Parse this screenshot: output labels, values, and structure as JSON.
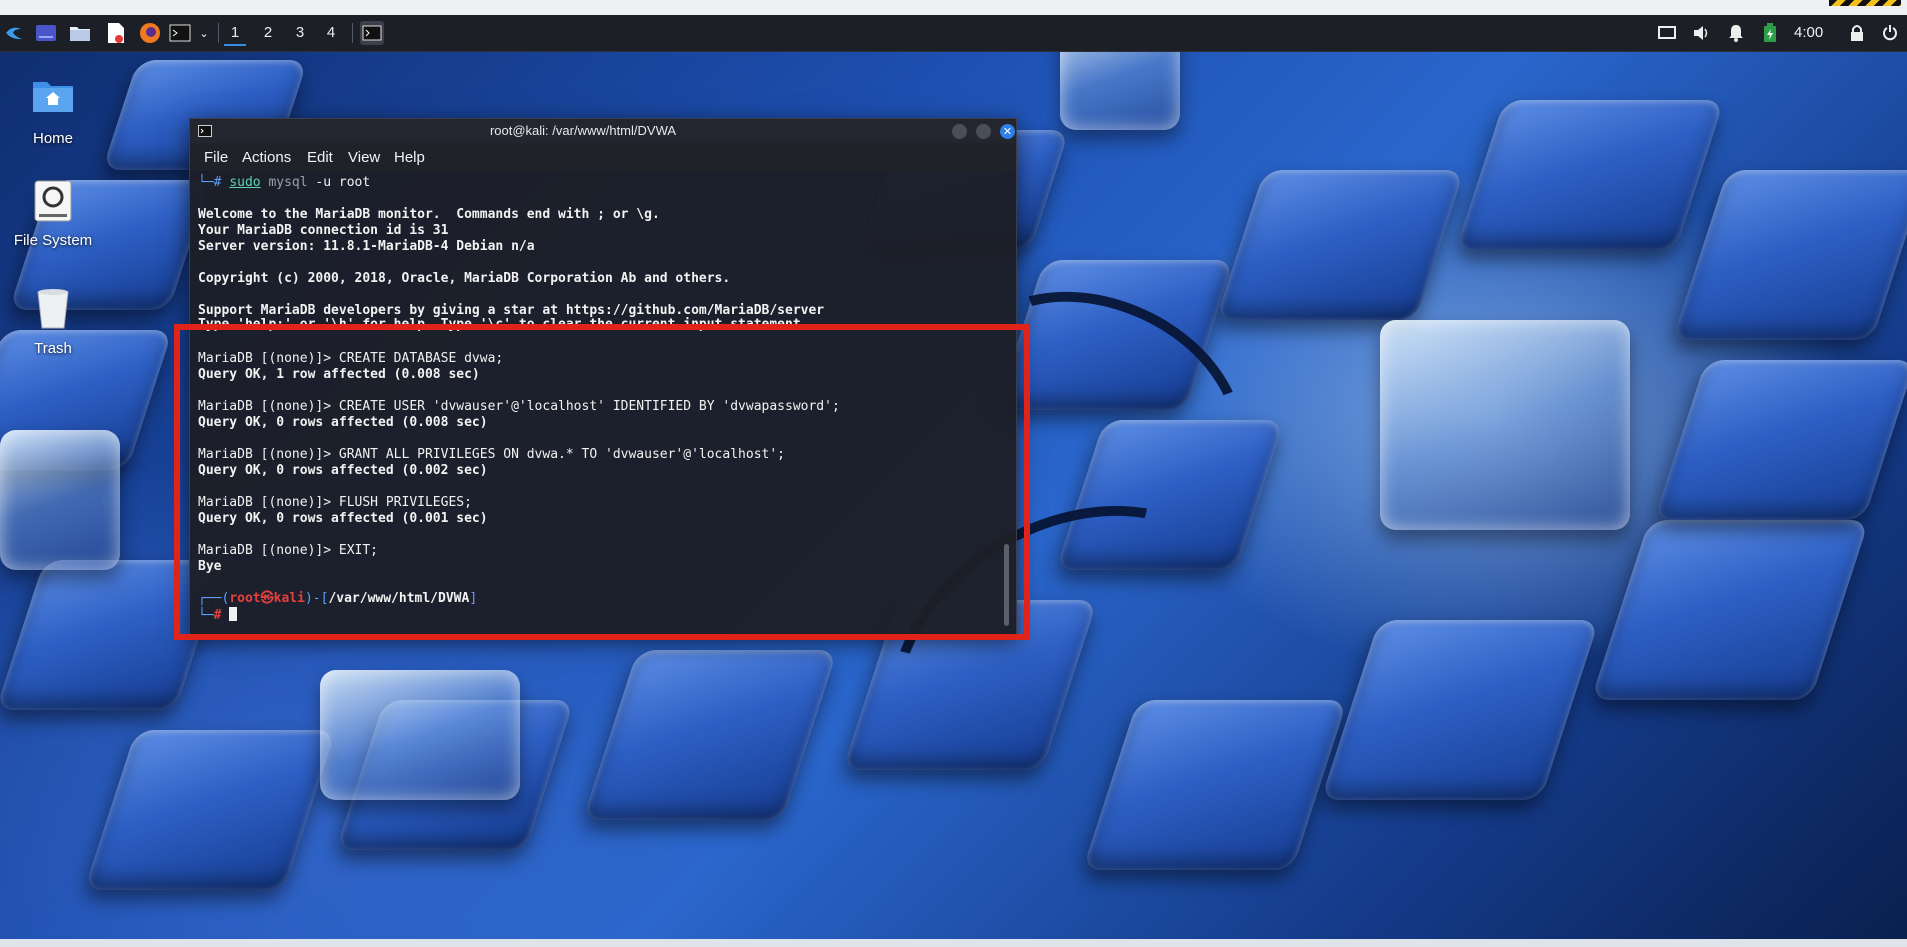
{
  "taskbar": {
    "workspaces": [
      "1",
      "2",
      "3",
      "4"
    ],
    "clock": "4:00",
    "icons": [
      "kali-menu-icon",
      "desktop-icon",
      "file-manager-icon",
      "text-editor-icon",
      "firefox-icon",
      "terminal-icon",
      "dropdown-icon",
      "terminal-task-icon",
      "display-icon",
      "volume-icon",
      "notification-icon",
      "battery-icon",
      "lock-icon",
      "power-icon"
    ]
  },
  "desktop": {
    "icons": [
      {
        "label": "Home",
        "icon": "home-folder-icon"
      },
      {
        "label": "File System",
        "icon": "drive-icon"
      },
      {
        "label": "Trash",
        "icon": "trash-icon"
      }
    ]
  },
  "terminal": {
    "title": "root@kali: /var/www/html/DVWA",
    "menu": [
      "File",
      "Actions",
      "Edit",
      "View",
      "Help"
    ],
    "prompt_cmd": {
      "prefix": "└─# ",
      "sudo": "sudo",
      "mysql": "mysql",
      "args": " -u root"
    },
    "lines": {
      "welcome": "Welcome to the MariaDB monitor.  Commands end with ; or \\g.",
      "connection": "Your MariaDB connection id is 31",
      "server": "Server version: 11.8.1-MariaDB-4 Debian n/a",
      "copyright": "Copyright (c) 2000, 2018, Oracle, MariaDB Corporation Ab and others.",
      "support": "Support MariaDB developers by giving a star at https://github.com/MariaDB/server",
      "help": "Type 'help;' or '\\h' for help. Type '\\c' to clear the current input statement.",
      "cmd1": "MariaDB [(none)]> CREATE DATABASE dvwa;",
      "res1": "Query OK, 1 row affected (0.008 sec)",
      "cmd2": "MariaDB [(none)]> CREATE USER 'dvwauser'@'localhost' IDENTIFIED BY 'dvwapassword';",
      "res2": "Query OK, 0 rows affected (0.008 sec)",
      "cmd3": "MariaDB [(none)]> GRANT ALL PRIVILEGES ON dvwa.* TO 'dvwauser'@'localhost';",
      "res3": "Query OK, 0 rows affected (0.002 sec)",
      "cmd4": "MariaDB [(none)]> FLUSH PRIVILEGES;",
      "res4": "Query OK, 0 rows affected (0.001 sec)",
      "cmd5": "MariaDB [(none)]> EXIT;",
      "res5": "Bye"
    },
    "final_prompt": {
      "open": "┌──(",
      "user": "root",
      "at": "㉿",
      "host": "kali",
      "mid": ")-[",
      "path": "/var/www/html/DVWA",
      "close": "]",
      "second": "└─",
      "hash": "#"
    }
  },
  "colors": {
    "highlight": "#e2231a",
    "accent": "#2f7fe8",
    "prompt_red": "#e6403d",
    "prompt_blue": "#5aa0ff"
  }
}
